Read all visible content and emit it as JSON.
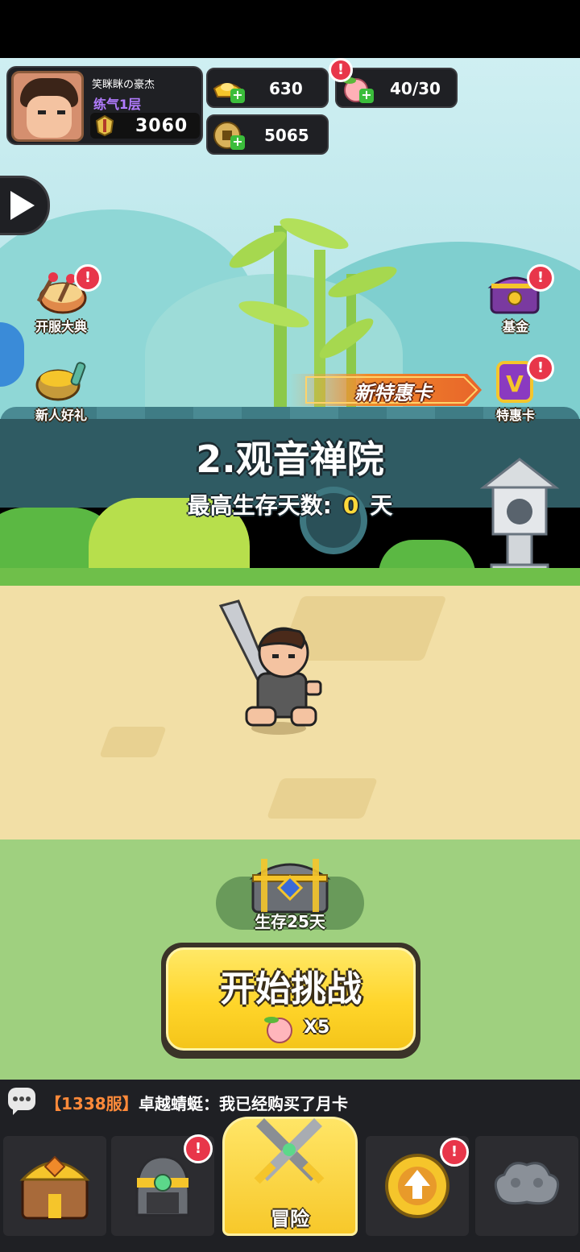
{
  "player": {
    "name": "笑眯眯の豪杰",
    "level": "练气1层",
    "power": "3060"
  },
  "resources": {
    "gold_ingot": {
      "value": "630",
      "icon": "gold-ingot-icon"
    },
    "peach_stamina": {
      "value": "40/30",
      "icon": "peach-icon"
    },
    "coin": {
      "value": "5065",
      "icon": "copper-coin-icon"
    }
  },
  "badge_text": "!",
  "events": {
    "left": [
      {
        "label": "开服大典",
        "icon": "drum-icon"
      },
      {
        "label": "新人好礼",
        "icon": "gift-pot-icon"
      }
    ],
    "right": [
      {
        "label": "基金",
        "icon": "treasure-chest-icon"
      },
      {
        "label": "特惠卡",
        "icon": "vip-card-icon"
      }
    ]
  },
  "deal_banner": "新特惠卡",
  "stage": {
    "title": "2.观音禅院",
    "survive_prefix": "最高生存天数:",
    "survive_days": "0",
    "survive_unit": "天"
  },
  "chest": {
    "label": "生存25天"
  },
  "start_button": {
    "label": "开始挑战",
    "cost": "X5"
  },
  "chat": {
    "server": "【1338服】",
    "message": "卓越蜻蜓：我已经购买了月卡"
  },
  "nav": {
    "active_label": "冒险",
    "items": [
      "shop-chest-icon",
      "helmet-icon",
      "crossed-swords-icon",
      "upgrade-arrow-icon",
      "locked-cloud-icon"
    ]
  },
  "colors": {
    "accent_yellow": "#ffd52a",
    "badge_red": "#e8364a",
    "level_purple": "#b27cff",
    "server_orange": "#ff8a3a"
  }
}
